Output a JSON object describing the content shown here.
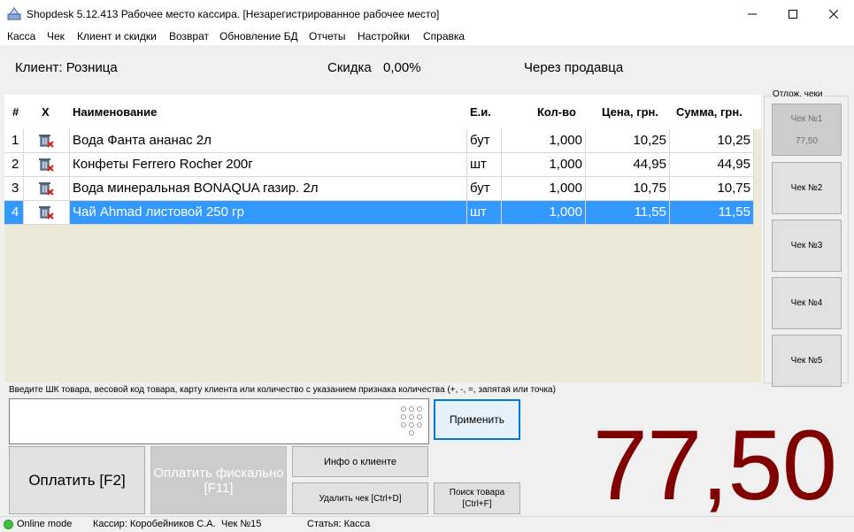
{
  "window": {
    "title": "Shopdesk 5.12.413 Рабочее место кассира. [Незарегистрированное рабочее место]",
    "app_icon": "shopdesk-icon"
  },
  "menu": [
    "Касса",
    "Чек",
    "Клиент и скидки",
    "Возврат",
    "Обновление БД",
    "Отчеты",
    "Настройки",
    "Справка"
  ],
  "info": {
    "client": "Клиент: Розница",
    "discount_label": "Скидка",
    "discount_value": "0,00%",
    "mode": "Через продавца"
  },
  "grid": {
    "columns": [
      "#",
      "X",
      "Наименование",
      "Е.и.",
      "Кол-во",
      "Цена, грн.",
      "Сумма, грн."
    ],
    "rows": [
      {
        "num": "1",
        "name": "Вода Фанта ананас 2л",
        "unit": "бут",
        "qty": "1,000",
        "price": "10,25",
        "sum": "10,25"
      },
      {
        "num": "2",
        "name": "Конфеты Ferrero Rocher 200г",
        "unit": "шт",
        "qty": "1,000",
        "price": "44,95",
        "sum": "44,95"
      },
      {
        "num": "3",
        "name": "Вода минеральная BONAQUA газир. 2л",
        "unit": "бут",
        "qty": "1,000",
        "price": "10,75",
        "sum": "10,75"
      },
      {
        "num": "4",
        "name": "Чай Ahmad листовой 250 гр",
        "unit": "шт",
        "qty": "1,000",
        "price": "11,55",
        "sum": "11,55"
      }
    ],
    "selected_row": 4
  },
  "held_checks": {
    "legend": "Отлож. чеки",
    "items": [
      {
        "label": "Чек №1",
        "amount": "77,50"
      },
      {
        "label": "Чек №2"
      },
      {
        "label": "Чек №3"
      },
      {
        "label": "Чек №4"
      },
      {
        "label": "Чек №5"
      }
    ]
  },
  "input": {
    "hint": "Введите ШК товара, весовой код товара,  карту клиента или количество с указанием признака количества (+, -, =, запятая или точка)",
    "value": "",
    "apply_label": "Применить"
  },
  "buttons": {
    "pay": "Оплатить [F2]",
    "pay_fiscal": "Оплатить фискально [F11]",
    "client_info": "Инфо о клиенте",
    "delete_check": "Удалить чек [Ctrl+D]",
    "search_product": "Поиск товара [Ctrl+F]"
  },
  "total": "77,50",
  "status": {
    "mode": "Online mode",
    "cashier": "Кассир: Коробейников С.А.",
    "check": "Чек №15",
    "article": "Статья: Касса"
  },
  "colors": {
    "total": "#800000",
    "selection": "#3399ff",
    "online": "#3fbf3f"
  }
}
